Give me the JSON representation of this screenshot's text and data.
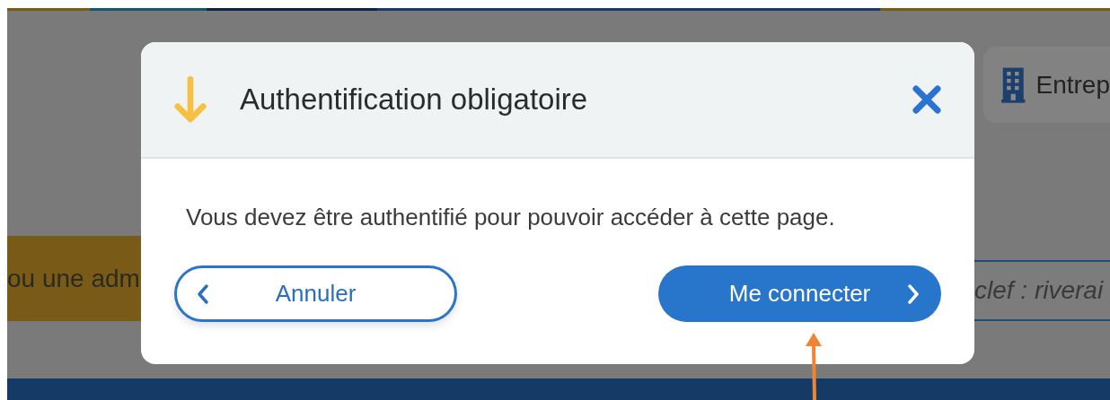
{
  "background": {
    "card": {
      "label": "Entrep"
    },
    "banner": {
      "text": "ou une adm"
    },
    "search": {
      "placeholder": "clef : riverai"
    }
  },
  "dialog": {
    "title": "Authentification obligatoire",
    "message": "Vous devez être authentifié pour pouvoir accéder à cette page.",
    "buttons": [
      {
        "label": "Annuler",
        "kind": "secondary"
      },
      {
        "label": "Me connecter",
        "kind": "primary"
      }
    ]
  }
}
